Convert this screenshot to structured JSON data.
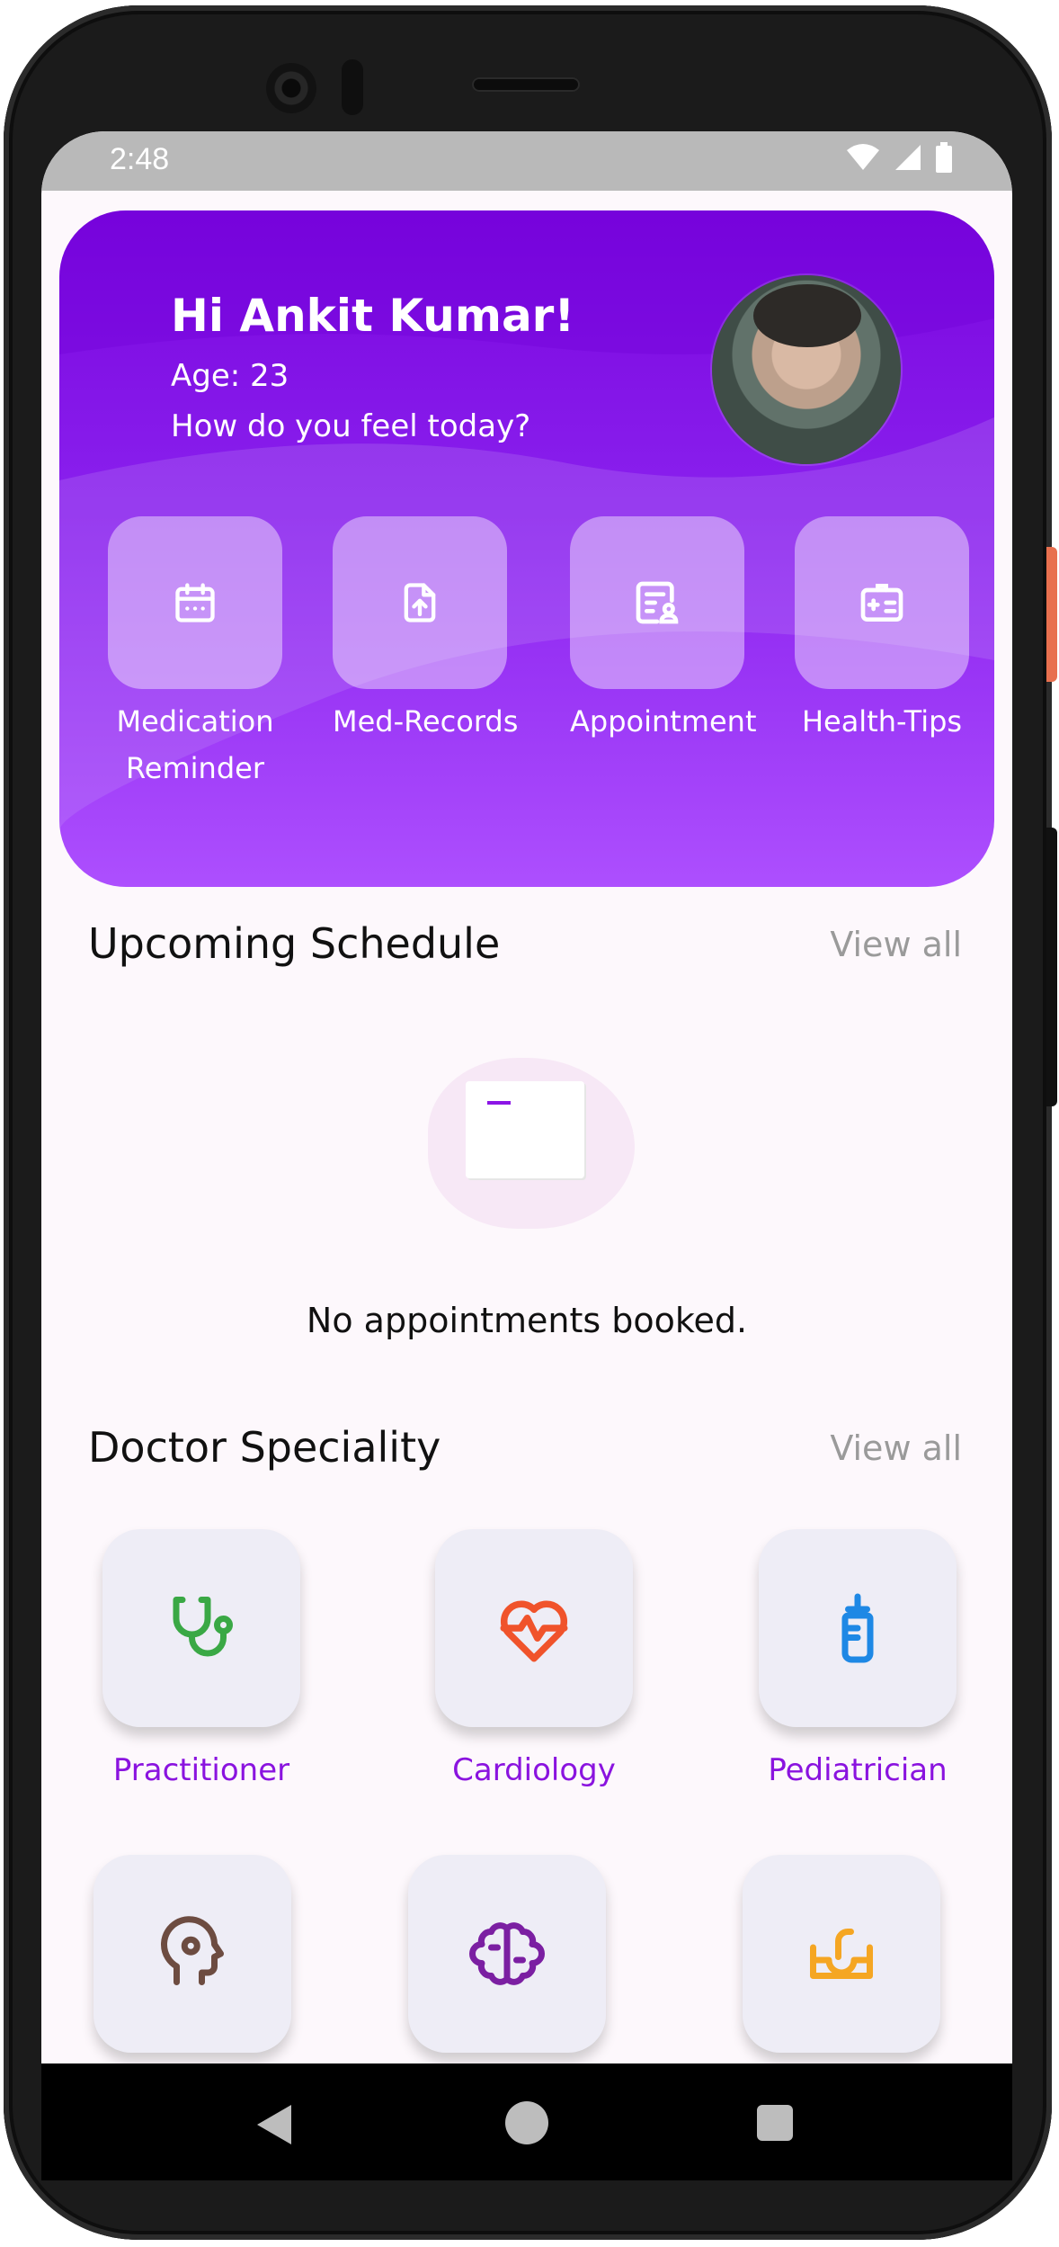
{
  "status": {
    "time": "2:48"
  },
  "header": {
    "greeting": "Hi Ankit Kumar!",
    "age": "Age: 23",
    "question": "How do you feel today?",
    "quick_actions": [
      {
        "label": "Medication",
        "label2": "Reminder",
        "icon": "calendar-icon"
      },
      {
        "label": "Med-Records",
        "icon": "file-upload-icon"
      },
      {
        "label": "Appointment",
        "icon": "appointment-icon"
      },
      {
        "label": "Health-Tips",
        "icon": "medical-id-icon"
      }
    ]
  },
  "schedule": {
    "title": "Upcoming Schedule",
    "view_all": "View all",
    "empty_message": "No appointments booked."
  },
  "speciality": {
    "title": "Doctor Speciality",
    "view_all": "View all",
    "items": [
      {
        "label": "Practitioner",
        "icon": "stethoscope-icon",
        "color": "#3aa845"
      },
      {
        "label": "Cardiology",
        "icon": "heartbeat-icon",
        "color": "#f0532b"
      },
      {
        "label": "Pediatrician",
        "icon": "baby-bottle-icon",
        "color": "#1e88e5"
      },
      {
        "label": "",
        "icon": "head-gear-icon",
        "color": "#6d4c41"
      },
      {
        "label": "",
        "icon": "brain-icon",
        "color": "#7b1fa2"
      },
      {
        "label": "",
        "icon": "skin-icon",
        "color": "#f5a623"
      }
    ]
  },
  "colors": {
    "primary": "#7a05de",
    "primary_light": "#ad4ffe",
    "label": "#8a13df"
  }
}
